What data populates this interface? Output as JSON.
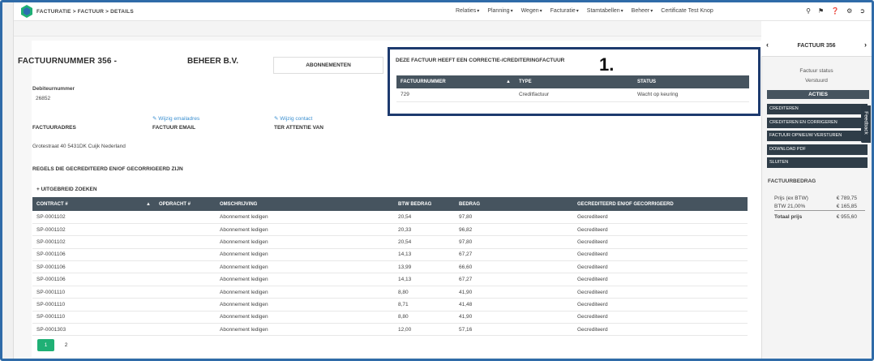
{
  "header": {
    "breadcrumb": "FACTURATIE > FACTUUR > DETAILS",
    "nav": [
      "Relaties",
      "Planning",
      "Wegen",
      "Facturatie",
      "Stamtabellen",
      "Beheer",
      "Certificate Test Knop"
    ],
    "icons": [
      "search-icon",
      "bell-icon",
      "help-icon",
      "settings-icon",
      "logout-icon"
    ]
  },
  "invoice": {
    "title_prefix": "FACTUURNUMMER 356 -",
    "title_suffix": "BEHEER B.V.",
    "abonnementen_label": "ABONNEMENTEN",
    "debiteur_label": "Debiteurnummer",
    "debiteur_value": "26852",
    "wijzig_email": "Wijzig emailadres",
    "wijzig_contact": "Wijzig contact",
    "factuuradres_label": "FACTUURADRES",
    "factuur_email_label": "FACTUUR EMAIL",
    "ter_attentie_label": "TER ATTENTIE VAN",
    "address": "Grotestraat 40 5431DK Cuijk Nederland"
  },
  "correction": {
    "title": "DEZE FACTUUR HEEFT EEN CORRECTIE-/CREDITERINGFACTUUR",
    "annotation": "1.",
    "headers": [
      "FACTUURNUMMER",
      "TYPE",
      "STATUS"
    ],
    "rows": [
      [
        "729",
        "Creditfactuur",
        "Wacht op keuring"
      ]
    ]
  },
  "lines": {
    "title": "REGELS DIE GECREDITEERD EN/OF GECORRIGEERD ZIJN",
    "search_label": "UITGEBREID ZOEKEN",
    "headers": [
      "CONTRACT #",
      "OPDRACHT #",
      "OMSCHRIJVING",
      "BTW BEDRAG",
      "BEDRAG",
      "GECREDITEERD EN/OF GECORRIGEERD"
    ],
    "rows": [
      [
        "SP-0001102",
        "",
        "Abonnement ledigen",
        "20,54",
        "97,80",
        "Gecrediteerd"
      ],
      [
        "SP-0001102",
        "",
        "Abonnement ledigen",
        "20,33",
        "96,82",
        "Gecrediteerd"
      ],
      [
        "SP-0001102",
        "",
        "Abonnement ledigen",
        "20,54",
        "97,80",
        "Gecrediteerd"
      ],
      [
        "SP-0001106",
        "",
        "Abonnement ledigen",
        "14,13",
        "67,27",
        "Gecrediteerd"
      ],
      [
        "SP-0001106",
        "",
        "Abonnement ledigen",
        "13,99",
        "66,60",
        "Gecrediteerd"
      ],
      [
        "SP-0001106",
        "",
        "Abonnement ledigen",
        "14,13",
        "67,27",
        "Gecrediteerd"
      ],
      [
        "SP-0001110",
        "",
        "Abonnement ledigen",
        "8,80",
        "41,90",
        "Gecrediteerd"
      ],
      [
        "SP-0001110",
        "",
        "Abonnement ledigen",
        "8,71",
        "41,48",
        "Gecrediteerd"
      ],
      [
        "SP-0001110",
        "",
        "Abonnement ledigen",
        "8,80",
        "41,90",
        "Gecrediteerd"
      ],
      [
        "SP-0001303",
        "",
        "Abonnement ledigen",
        "12,00",
        "57,16",
        "Gecrediteerd"
      ]
    ],
    "pages": [
      "1",
      "2"
    ]
  },
  "sidebar": {
    "title": "FACTUUR 356",
    "status_label": "Factuur status",
    "status_value": "Verstuurd",
    "acties_label": "ACTIES",
    "actions": [
      "CREDITEREN",
      "CREDITEREN EN CORRIGEREN",
      "FACTUUR OPNIEUW VERSTUREN",
      "DOWNLOAD PDF",
      "SLUITEN"
    ],
    "feedback_label": "Feedback",
    "bedrag_title": "FACTUURBEDRAG",
    "prijs_ex_label": "Prijs (ex BTW)",
    "prijs_ex_value": "€ 789,75",
    "btw_label": "BTW 21,00%",
    "btw_value": "€ 165,85",
    "totaal_label": "Totaal prijs",
    "totaal_value": "€ 955,60"
  },
  "colors": {
    "accent_green": "#1fb075",
    "table_header": "#46545f",
    "action_button": "#2f3d48",
    "highlight_box": "#1d3a6e",
    "link": "#3a8fd0"
  }
}
